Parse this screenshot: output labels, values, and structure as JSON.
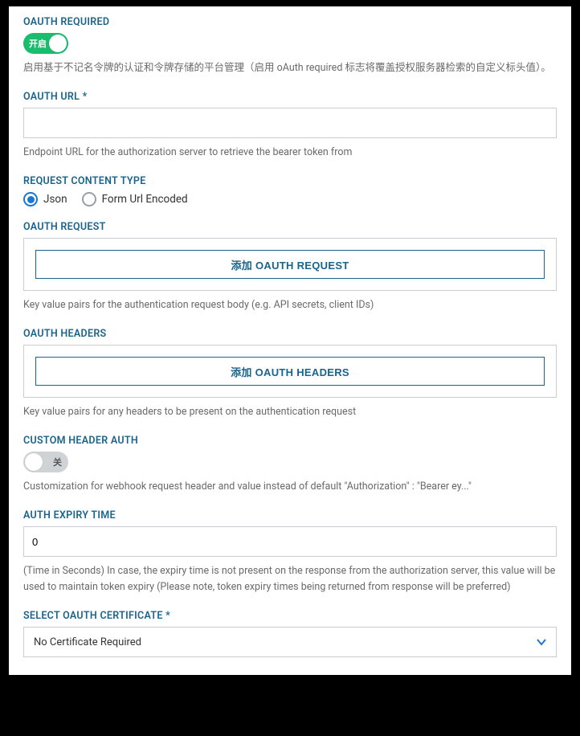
{
  "oauth_required": {
    "label": "OAUTH REQUIRED",
    "toggle_on_text": "开启",
    "desc": "启用基于不记名令牌的认证和令牌存储的平台管理（启用 oAuth required 标志将覆盖授权服务器检索的自定义标头值）。"
  },
  "oauth_url": {
    "label": "OAUTH URL *",
    "value": "",
    "desc": "Endpoint URL for the authorization server to retrieve the bearer token from"
  },
  "content_type": {
    "label": "REQUEST CONTENT TYPE",
    "opt_json": "Json",
    "opt_form": "Form Url Encoded"
  },
  "oauth_request": {
    "label": "OAUTH REQUEST",
    "add_button": "添加 OAUTH REQUEST",
    "desc": "Key value pairs for the authentication request body (e.g. API secrets, client IDs)"
  },
  "oauth_headers": {
    "label": "OAUTH HEADERS",
    "add_button": "添加 OAUTH HEADERS",
    "desc": "Key value pairs for any headers to be present on the authentication request"
  },
  "custom_header": {
    "label": "CUSTOM HEADER AUTH",
    "toggle_off_text": "关",
    "desc": "Customization for webhook request header and value instead of default \"Authorization\" : \"Bearer ey...\""
  },
  "auth_expiry": {
    "label": "AUTH EXPIRY TIME",
    "value": "0",
    "desc": "(Time in Seconds) In case, the expiry time is not present on the response from the authorization server, this value will be used to maintain token expiry (Please note, token expiry times being returned from response will be preferred)"
  },
  "select_cert": {
    "label": "SELECT OAUTH CERTIFICATE *",
    "value": "No Certificate Required"
  }
}
